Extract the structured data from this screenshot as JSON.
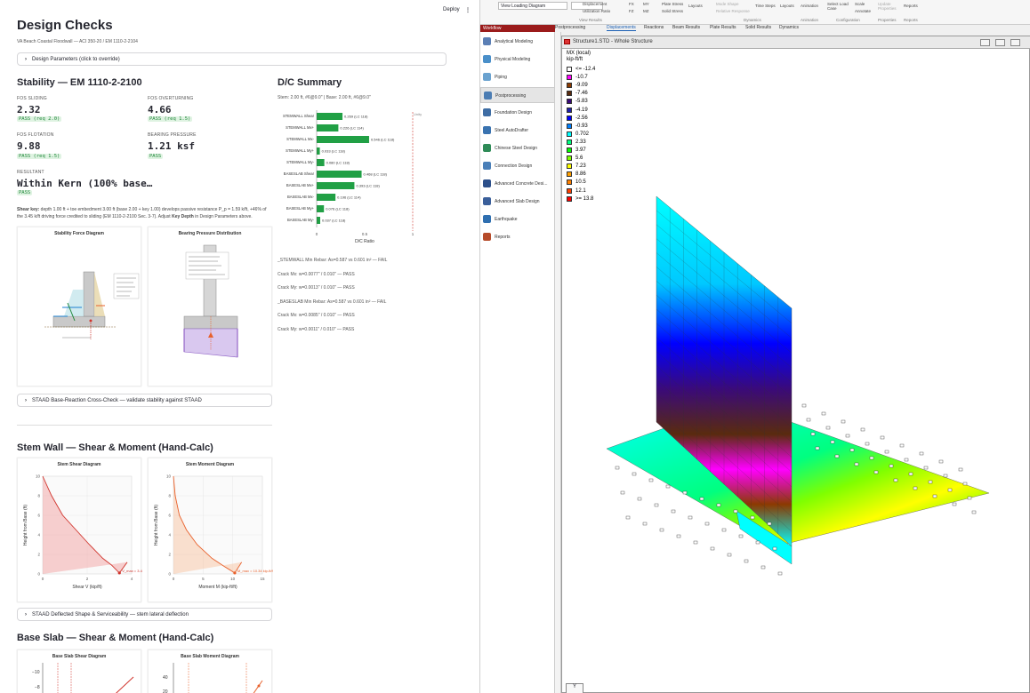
{
  "left": {
    "title": "Design Checks",
    "deploy_label": "Deploy",
    "menu_label": "⋮",
    "subtitle": "VA Beach Coastal Floodwall — ACI 350-20 / EM 1110-2-2104",
    "design_params_expander": "Design Parameters (click to override)",
    "stability": {
      "heading": "Stability — EM 1110-2-2100",
      "metrics": [
        {
          "label": "FOS SLIDING",
          "value": "2.32",
          "badge": "PASS (req 2.0)"
        },
        {
          "label": "FOS OVERTURNING",
          "value": "4.66",
          "badge": "PASS (req 1.5)"
        },
        {
          "label": "FOS FLOTATION",
          "value": "9.88",
          "badge": "PASS (req 1.5)"
        },
        {
          "label": "BEARING PRESSURE",
          "value": "1.21 ksf",
          "badge": "PASS"
        }
      ],
      "resultant_label": "RESULTANT",
      "resultant_value": "Within Kern (100% base…",
      "resultant_badge": "PASS",
      "shear_key_bold": "Shear key:",
      "shear_key_text_1": " depth 1.00 ft + toe embedment 3.00 ft (base 2.00 + key 1.00) develops passive resistance P_p = 1.59 k/ft, +46% of",
      "shear_key_text_2": "the 3.45 k/ft driving force credited to sliding (EM 1110-2-2100 Sec. 3-7). Adjust ",
      "shear_key_bold2": "Key Depth",
      "shear_key_text_3": " in Design Parameters above.",
      "fig1_title": "Stability Force Diagram",
      "fig2_title": "Bearing Pressure Distribution",
      "staad_expander": "STAAD Base-Reaction Cross-Check — validate stability against STAAD"
    },
    "dc": {
      "heading": "D/C Summary",
      "subtitle": "Stem: 2.00 ft, #6@9.0\" | Base: 2.00 ft, #6@9.0\"",
      "xlabel": "D/C Ratio",
      "limit_label": "Unity",
      "ticks": [
        "0",
        "0.5",
        "1"
      ],
      "lines": [
        {
          "text": "_STEMWALL Min Rebar: As=0.587 vs 0.601 in² — FAIL",
          "bold": "_STEMWALL"
        },
        {
          "text": "Crack Mx: w=0.0077\" / 0.010\" — PASS"
        },
        {
          "text": "Crack My: w=0.0013\" / 0.010\" — PASS"
        },
        {
          "text": "_BASESLAB Min Rebar: As=0.587 vs 0.601 in² — FAIL",
          "bold": "_BASESLAB"
        },
        {
          "text": "Crack Mx: w=0.0085\" / 0.010\" — PASS"
        },
        {
          "text": "Crack My: w=0.0011\" / 0.010\" — PASS"
        }
      ]
    },
    "stem": {
      "heading": "Stem Wall — Shear & Moment (Hand-Calc)",
      "shear_title": "Stem Shear Diagram",
      "moment_title": "Stem Moment Diagram",
      "shear_xlabel": "Shear V (kip/ft)",
      "moment_xlabel": "Moment M (kip-ft/ft)",
      "ylabel": "Height from Base (ft)",
      "shear_annot": "V_max = 3.45 kip/ft",
      "moment_annot": "M_max = 10.34 kip-ft/ft",
      "deflect_expander": "STAAD Deflected Shape & Serviceability — stem lateral deflection"
    },
    "base": {
      "heading": "Base Slab — Shear & Moment (Hand-Calc)",
      "shear_title": "Base Slab Shear Diagram",
      "moment_title": "Base Slab Moment Diagram"
    }
  },
  "chart_data": [
    {
      "type": "bar",
      "title": "",
      "xlabel": "D/C Ratio",
      "xlim": [
        0,
        1.0
      ],
      "categories": [
        "STEMWALL Shear",
        "STEMWALL Mx+",
        "STEMWALL Mx-",
        "STEMWALL My+",
        "STEMWALL My-",
        "BASESLAB Shear",
        "BASESLAB Mx+",
        "BASESLAB Mx-",
        "BASESLAB My+",
        "BASESLAB My-"
      ],
      "values": [
        0.269,
        0.226,
        0.546,
        0.033,
        0.08,
        0.468,
        0.393,
        0.196,
        0.076,
        0.037
      ],
      "value_labels": [
        "0.269 (LC 118)",
        "0.226 (LC 114)",
        "0.546 (LC 118)",
        "0.033 (LC 118)",
        "0.080 (LC 118)",
        "0.468 (LC 118)",
        "0.393 (LC 118)",
        "0.196 (LC 114)",
        "0.076 (LC 118)",
        "0.037 (LC 118)"
      ]
    },
    {
      "type": "line",
      "title": "Stem Shear Diagram",
      "xlabel": "Shear V (kip/ft)",
      "ylabel": "Height from Base (ft)",
      "xlim": [
        0,
        4
      ],
      "ylim": [
        0,
        10
      ],
      "xticks": [
        "0",
        "2",
        "4"
      ],
      "yticks": [
        "0",
        "2",
        "4",
        "6",
        "8",
        "10"
      ],
      "x": [
        0,
        0.4,
        0.9,
        1.5,
        2.1,
        2.7,
        3.1,
        3.45,
        3.8
      ],
      "y": [
        10,
        8,
        6,
        4.5,
        3,
        1.6,
        0.9,
        0.1,
        1.2
      ]
    },
    {
      "type": "line",
      "title": "Stem Moment Diagram",
      "xlabel": "Moment M (kip-ft/ft)",
      "ylabel": "Height from Base (ft)",
      "xlim": [
        0,
        15
      ],
      "ylim": [
        0,
        10
      ],
      "xticks": [
        "0",
        "5",
        "10",
        "15"
      ],
      "yticks": [
        "0",
        "2",
        "4",
        "6",
        "8",
        "10"
      ],
      "x": [
        0,
        0.3,
        1,
        2.2,
        4,
        6.5,
        8.5,
        10.34,
        11.5
      ],
      "y": [
        10,
        8,
        6,
        4.5,
        3,
        1.6,
        0.8,
        0.1,
        1.2
      ]
    }
  ],
  "right": {
    "ribbon": {
      "view_loading": "View Loading Diagram",
      "displacement": "Displacement",
      "utilization": "Utilization Ratio",
      "plate_stress": "Plate Stress",
      "solid_stress": "Solid Stress",
      "mode_shape": "Mode Shape",
      "relative_response": "Relative Response",
      "time_steps": "Time Steps",
      "layouts": "Layouts",
      "animation": "Animation",
      "select_load_case": "Select Load Case",
      "scale": "Scale",
      "annotate": "Annotate",
      "update_properties": "Update Properties",
      "reports": "Reports",
      "groups": [
        "View Results",
        "Dynamics",
        "Animation",
        "Configuration",
        "Properties",
        "Reports"
      ],
      "fx": "FX",
      "fy": "FY",
      "fz": "FZ",
      "mx": "MX",
      "my": "MY",
      "mz": "MZ"
    },
    "tabs": [
      "Postprocessing",
      "Displacements",
      "Reactions",
      "Beam Results",
      "Plate Results",
      "Solid Results",
      "Dynamics"
    ],
    "workflow_title": "Workflow",
    "workflow": [
      {
        "label": "Analytical Modeling",
        "color": "#5b7fb5"
      },
      {
        "label": "Physical Modeling",
        "color": "#4a8fc9"
      },
      {
        "label": "Piping",
        "color": "#6aa2cf"
      },
      {
        "label": "Postprocessing",
        "color": "#4c7db3",
        "active": true
      },
      {
        "label": "Foundation Design",
        "color": "#3e6da4"
      },
      {
        "label": "Steel AutoDrafter",
        "color": "#3a73b0"
      },
      {
        "label": "Chinese Steel Design",
        "color": "#2e8b57"
      },
      {
        "label": "Connection Design",
        "color": "#4a7fb8"
      },
      {
        "label": "Advanced Concrete Desi...",
        "color": "#2c4f8a"
      },
      {
        "label": "Advanced Slab Design",
        "color": "#3a5f9a"
      },
      {
        "label": "Earthquake",
        "color": "#2f6fb0"
      },
      {
        "label": "Reports",
        "color": "#b64b2a"
      }
    ],
    "window_title": "Structure1.STD - Whole Structure",
    "legend_title": "MX (local)",
    "legend_unit": "kip-ft/ft",
    "legend": [
      {
        "label": "<= -12.4",
        "color": "#ffffff"
      },
      {
        "label": "-10.7",
        "color": "#ff00ff"
      },
      {
        "label": "-9.09",
        "color": "#8b3a00"
      },
      {
        "label": "-7.46",
        "color": "#5a2b0e"
      },
      {
        "label": "-5.83",
        "color": "#3a0a7a"
      },
      {
        "label": "-4.19",
        "color": "#2020aa"
      },
      {
        "label": "-2.56",
        "color": "#0000ff"
      },
      {
        "label": "-0.93",
        "color": "#0080ff"
      },
      {
        "label": "0.702",
        "color": "#00ffff"
      },
      {
        "label": "2.33",
        "color": "#00ff80"
      },
      {
        "label": "3.97",
        "color": "#00ff00"
      },
      {
        "label": "5.6",
        "color": "#80ff00"
      },
      {
        "label": "7.23",
        "color": "#ffff00"
      },
      {
        "label": "8.86",
        "color": "#ffa000"
      },
      {
        "label": "10.5",
        "color": "#ff8000"
      },
      {
        "label": "12.1",
        "color": "#ff4000"
      },
      {
        "label": ">= 13.8",
        "color": "#ff0000"
      }
    ],
    "axis_label": "Y"
  }
}
